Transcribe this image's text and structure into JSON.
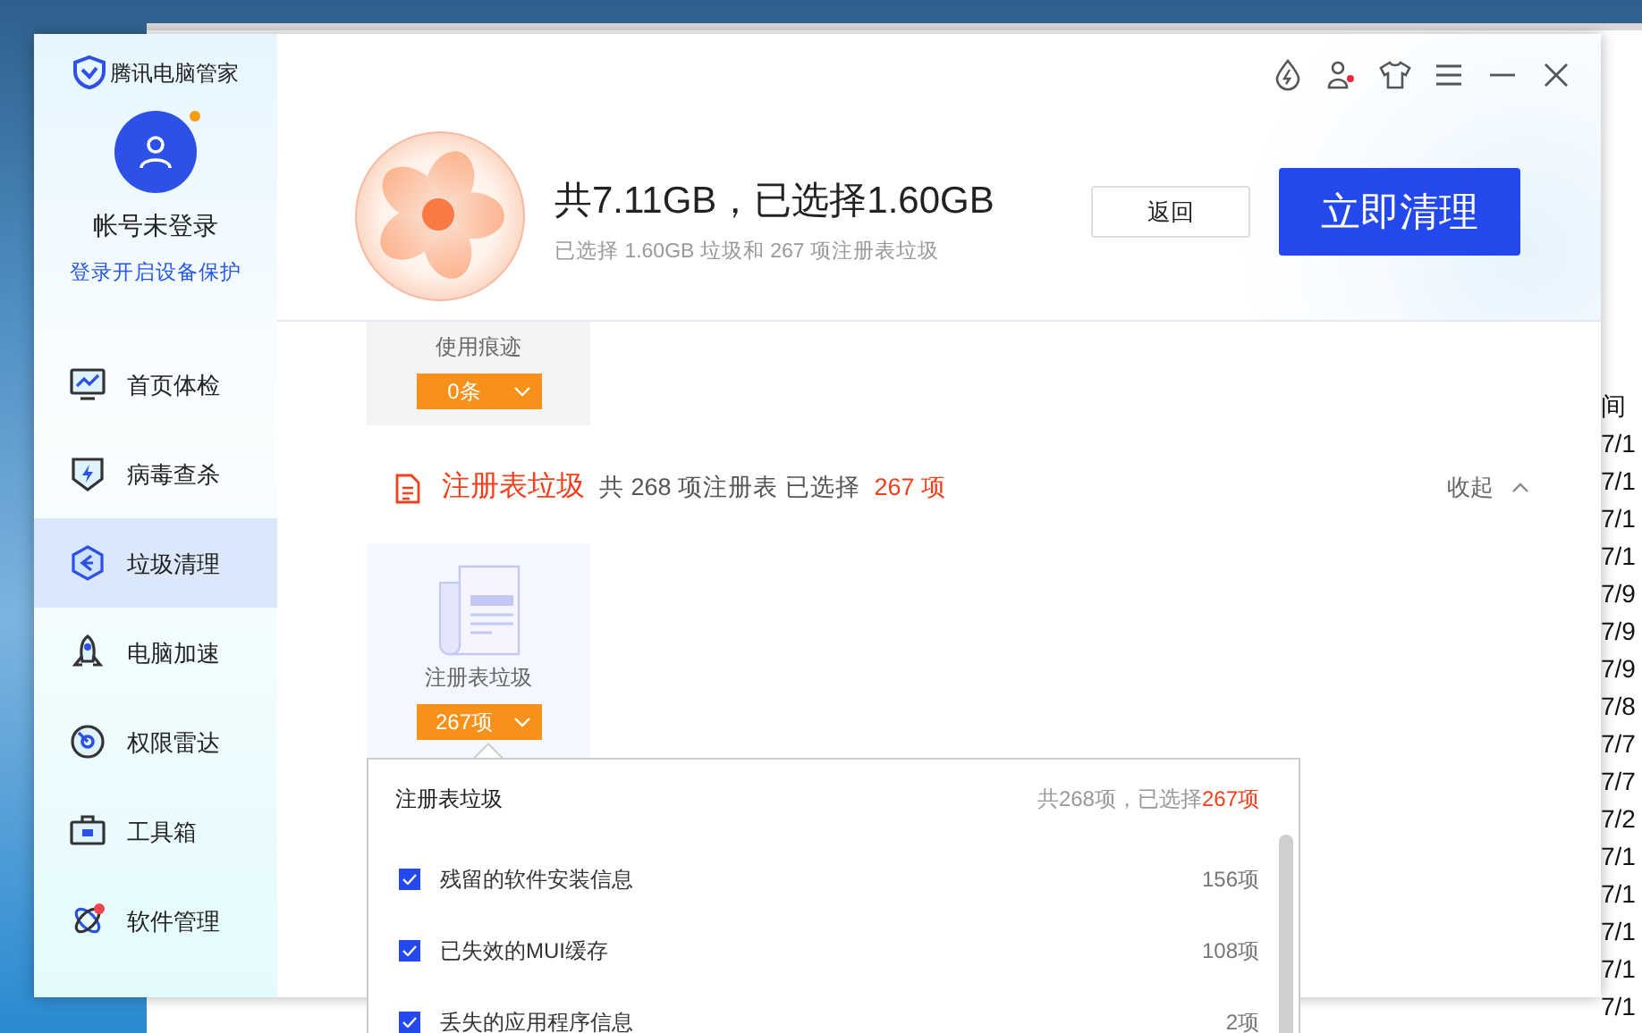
{
  "background_window": {
    "header": "间",
    "dates": [
      "7/1",
      "7/1",
      "7/1",
      "7/1",
      "7/9",
      "7/9",
      "7/9",
      "7/8",
      "7/7",
      "7/7",
      "7/2",
      "7/1",
      "7/1",
      "7/1",
      "7/1",
      "7/1"
    ]
  },
  "app": {
    "brand": "腾讯电脑管家",
    "account": {
      "status": "帐号未登录",
      "login_link": "登录开启设备保护",
      "notification": true
    },
    "nav": [
      {
        "label": "首页体检",
        "selected": false,
        "badge": false
      },
      {
        "label": "病毒查杀",
        "selected": false,
        "badge": false
      },
      {
        "label": "垃圾清理",
        "selected": true,
        "badge": false
      },
      {
        "label": "电脑加速",
        "selected": false,
        "badge": false
      },
      {
        "label": "权限雷达",
        "selected": false,
        "badge": false
      },
      {
        "label": "工具箱",
        "selected": false,
        "badge": false
      },
      {
        "label": "软件管理",
        "selected": false,
        "badge": true
      }
    ],
    "title_bar": {
      "user_notification": true
    },
    "header": {
      "title": "共7.11GB，已选择1.60GB",
      "subtitle": "已选择 1.60GB 垃圾和 267 项注册表垃圾",
      "back_button": "返回",
      "clean_button": "立即清理"
    },
    "trace_card": {
      "label": "使用痕迹",
      "count": "0条"
    },
    "section": {
      "title": "注册表垃圾",
      "summary": "共 268 项注册表 已选择",
      "summary_selected": "267 项",
      "collapse": "收起",
      "expanded": true
    },
    "registry_card": {
      "label": "注册表垃圾",
      "count": "267项"
    },
    "popup": {
      "title": "注册表垃圾",
      "total": "共268项，已选择",
      "selected_count": "267项",
      "items": [
        {
          "label": "残留的软件安装信息",
          "count": "156项",
          "checked": true
        },
        {
          "label": "已失效的MUI缓存",
          "count": "108项",
          "checked": true
        },
        {
          "label": "丢失的应用程序信息",
          "count": "2项",
          "checked": true
        }
      ]
    }
  }
}
